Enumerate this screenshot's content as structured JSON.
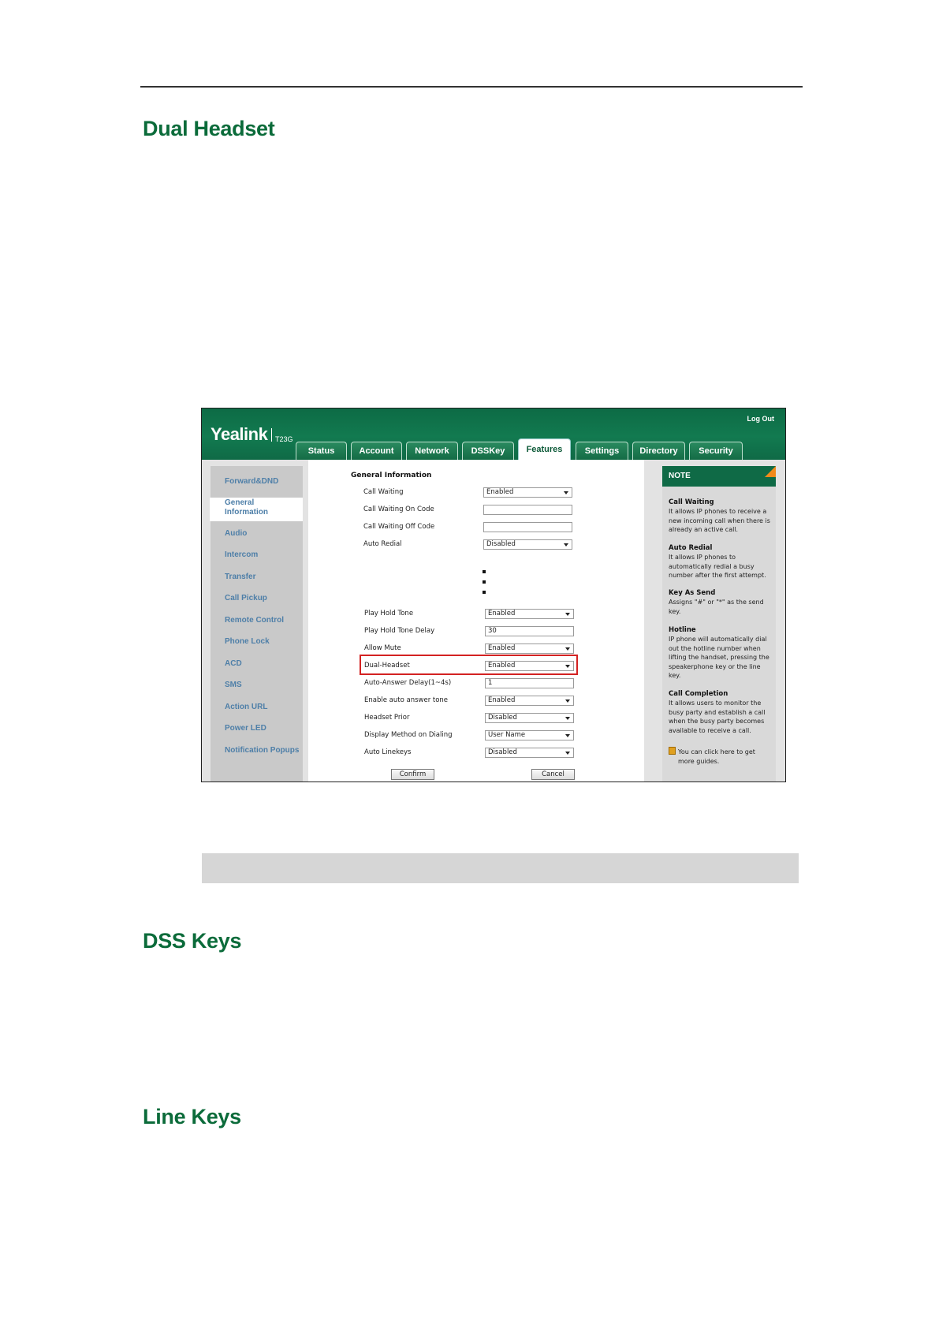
{
  "headings": {
    "dual_headset": "Dual Headset",
    "dss_keys": "DSS Keys",
    "line_keys": "Line Keys"
  },
  "ui": {
    "brand": "Yealink",
    "model": "T23G",
    "logout": "Log Out",
    "tabs": [
      "Status",
      "Account",
      "Network",
      "DSSKey",
      "Features",
      "Settings",
      "Directory",
      "Security"
    ],
    "active_tab": "Features",
    "nav": [
      "Forward&DND",
      "General\nInformation",
      "Audio",
      "Intercom",
      "Transfer",
      "Call Pickup",
      "Remote Control",
      "Phone Lock",
      "ACD",
      "SMS",
      "Action URL",
      "Power LED",
      "Notification Popups"
    ],
    "section_title": "General Information",
    "fields_top": [
      {
        "label": "Call Waiting",
        "value": "Enabled",
        "type": "select"
      },
      {
        "label": "Call Waiting On Code",
        "value": "",
        "type": "text"
      },
      {
        "label": "Call Waiting Off Code",
        "value": "",
        "type": "text"
      },
      {
        "label": "Auto Redial",
        "value": "Disabled",
        "type": "select"
      }
    ],
    "fields_bottom": [
      {
        "label": "Play Hold Tone",
        "value": "Enabled",
        "type": "select"
      },
      {
        "label": "Play Hold Tone Delay",
        "value": "30",
        "type": "text"
      },
      {
        "label": "Allow Mute",
        "value": "Enabled",
        "type": "select"
      },
      {
        "label": "Dual-Headset",
        "value": "Enabled",
        "type": "select"
      },
      {
        "label": "Auto-Answer Delay(1~4s)",
        "value": "1",
        "type": "text"
      },
      {
        "label": "Enable auto answer tone",
        "value": "Enabled",
        "type": "select"
      },
      {
        "label": "Headset Prior",
        "value": "Disabled",
        "type": "select"
      },
      {
        "label": "Display Method on Dialing",
        "value": "User Name",
        "type": "select"
      },
      {
        "label": "Auto Linekeys",
        "value": "Disabled",
        "type": "select"
      }
    ],
    "confirm": "Confirm",
    "cancel": "Cancel",
    "note": {
      "title": "NOTE",
      "items": [
        {
          "title": "Call Waiting",
          "text": "It allows IP phones to receive a new incoming call when there is already an active call."
        },
        {
          "title": "Auto Redial",
          "text": "It allows IP phones to automatically redial a busy number after the first attempt."
        },
        {
          "title": "Key As Send",
          "text": "Assigns \"#\" or \"*\" as the send key."
        },
        {
          "title": "Hotline",
          "text": "IP phone will automatically dial out the hotline number when lifting the handset, pressing the speakerphone key or the line key."
        },
        {
          "title": "Call Completion",
          "text": "It allows users to monitor the busy party and establish a call when the busy party becomes available to receive a call."
        }
      ],
      "tip": "You can click here to get more guides."
    }
  }
}
